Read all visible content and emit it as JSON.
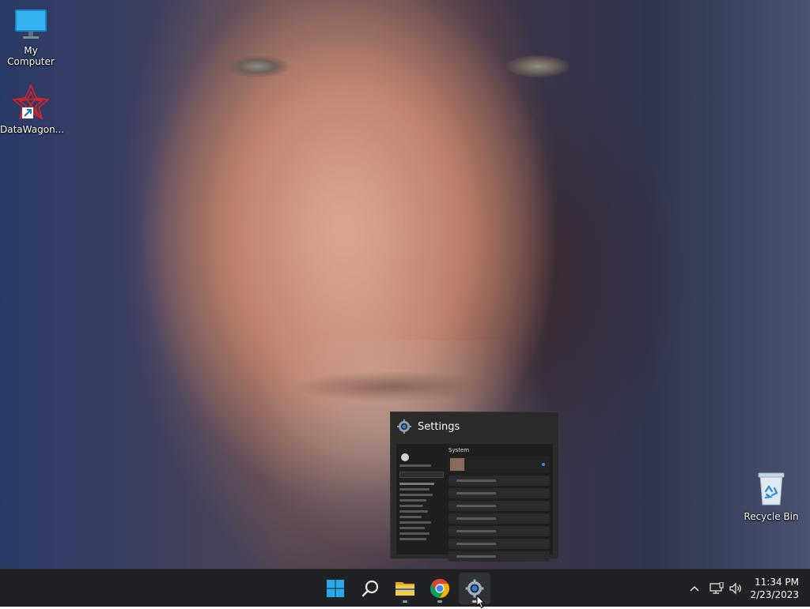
{
  "desktop": {
    "icons": [
      {
        "label": "My Computer",
        "icon": "monitor-icon"
      },
      {
        "label": "DataWagon...",
        "icon": "datawagon-icon"
      },
      {
        "label": "Recycle Bin",
        "icon": "recycle-bin-icon"
      }
    ]
  },
  "preview": {
    "title": "Settings",
    "icon": "gear-icon",
    "thumbnail_heading": "System"
  },
  "taskbar": {
    "items": [
      {
        "name": "Start",
        "icon": "windows-start-icon"
      },
      {
        "name": "Search",
        "icon": "search-icon"
      },
      {
        "name": "File Explorer",
        "icon": "folder-icon"
      },
      {
        "name": "Google Chrome",
        "icon": "chrome-icon"
      },
      {
        "name": "Settings",
        "icon": "gear-icon"
      }
    ],
    "tray": {
      "time": "11:34 PM",
      "date": "2/23/2023"
    }
  },
  "colors": {
    "taskbar_bg": "#1f2124",
    "accent": "#0078d4"
  }
}
